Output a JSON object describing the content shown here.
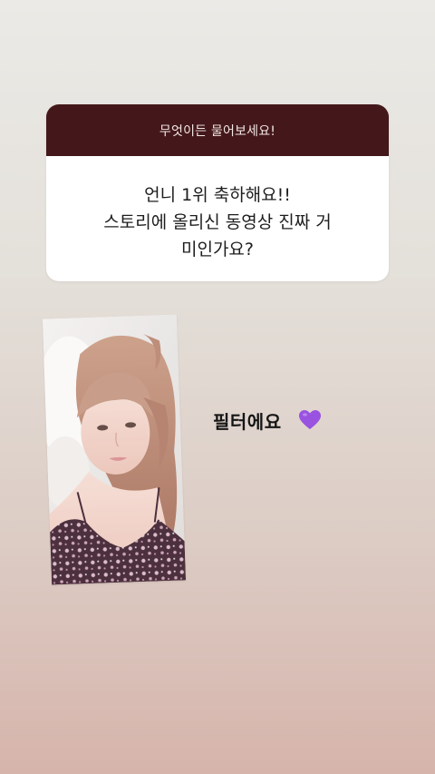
{
  "question_sticker": {
    "prompt": "무엇이든 물어보세요!",
    "question": "언니 1위 축하해요!!\n스토리에 올리신 동영상 진짜 거\n미인가요?"
  },
  "reply": {
    "text": "필터에요",
    "emoji_icon": "purple-heart-icon"
  },
  "colors": {
    "header_bg": "#44181b",
    "heart": "#9a52e0"
  }
}
